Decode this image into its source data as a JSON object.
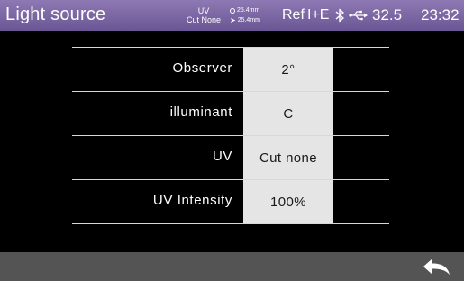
{
  "header": {
    "title": "Light source",
    "uv_line1": "UV",
    "uv_line2": "Cut None",
    "aperture_measure": "25.4mm",
    "aperture_illum": "25.4mm",
    "reference": "Ref",
    "mode": "I+E",
    "temperature": "32.5",
    "time": "23:32"
  },
  "settings": [
    {
      "label": "Observer",
      "value": "2°"
    },
    {
      "label": "illuminant",
      "value": "C"
    },
    {
      "label": "UV",
      "value": "Cut none"
    },
    {
      "label": "UV Intensity",
      "value": "100%"
    }
  ],
  "colors": {
    "header_bg": "#7b66a3",
    "value_bg": "#e5e5e5",
    "footer_bg": "#545454"
  },
  "icons": [
    "bluetooth-icon",
    "usb-icon",
    "aperture-icon",
    "back-arrow-icon"
  ]
}
